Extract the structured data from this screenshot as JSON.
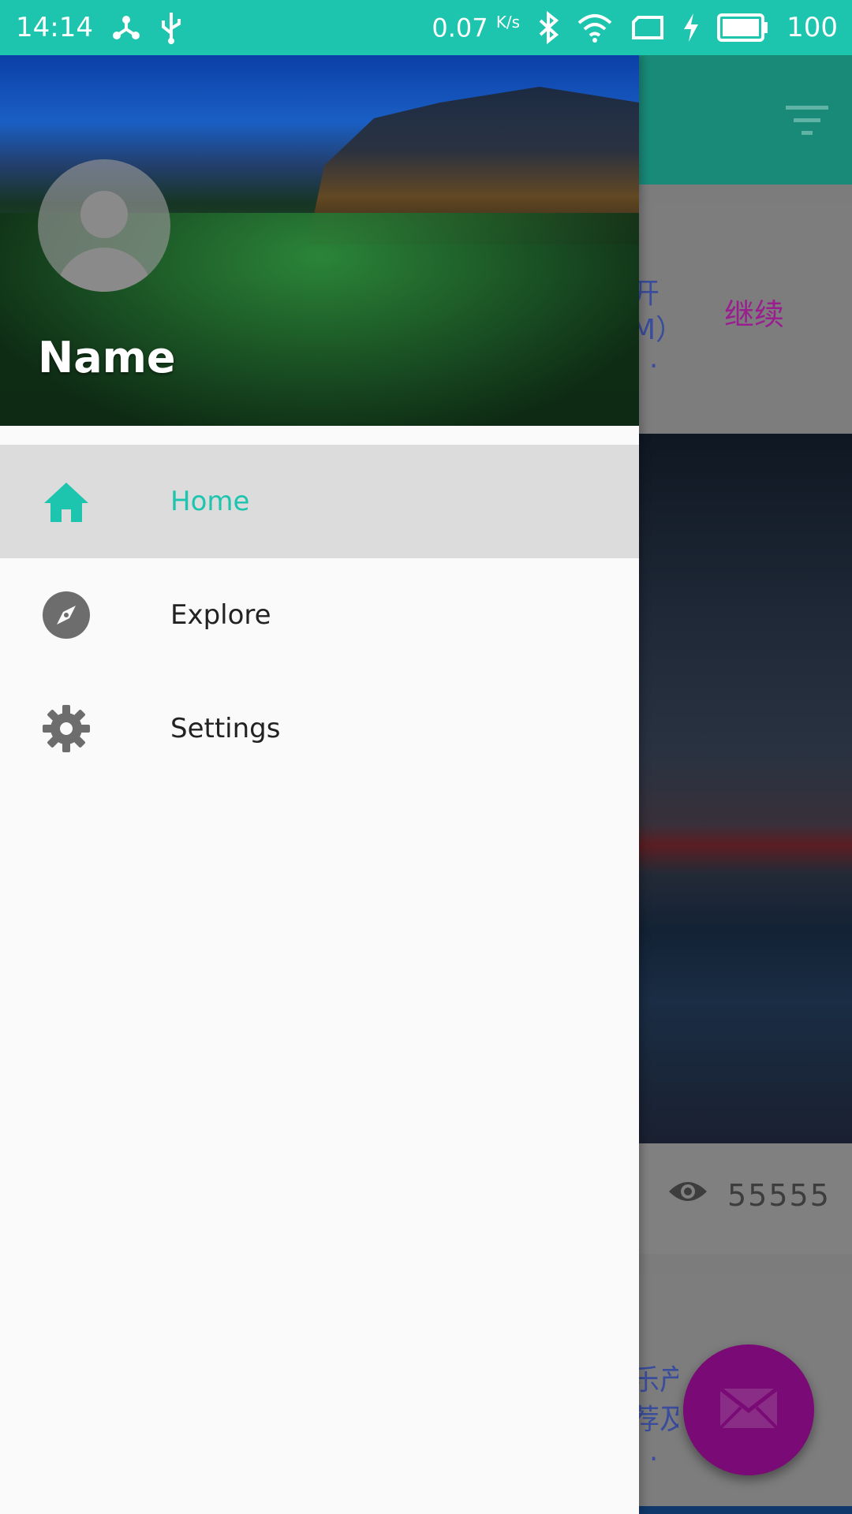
{
  "status_bar": {
    "time": "14:14",
    "net_speed": "0.07",
    "net_unit": "K/s",
    "battery": "100",
    "icons": [
      "share-icon",
      "usb-icon",
      "bluetooth-icon",
      "wifi-icon",
      "sim-icon",
      "charging-icon",
      "battery-icon"
    ]
  },
  "drawer": {
    "user_name": "Name",
    "menu": [
      {
        "label": "Home",
        "icon": "home-icon",
        "active": true
      },
      {
        "label": "Explore",
        "icon": "compass-icon",
        "active": false
      },
      {
        "label": "Settings",
        "icon": "gear-icon",
        "active": false
      }
    ]
  },
  "background": {
    "card1_text": "开\nM）\n· ·",
    "continue_label": "继续",
    "views": "55555",
    "card2_text": "乐产\n荐及\n· ·"
  },
  "colors": {
    "accent": "#1dc4ae",
    "fab": "#7a0a75",
    "continue_text": "#9a1e8f"
  }
}
